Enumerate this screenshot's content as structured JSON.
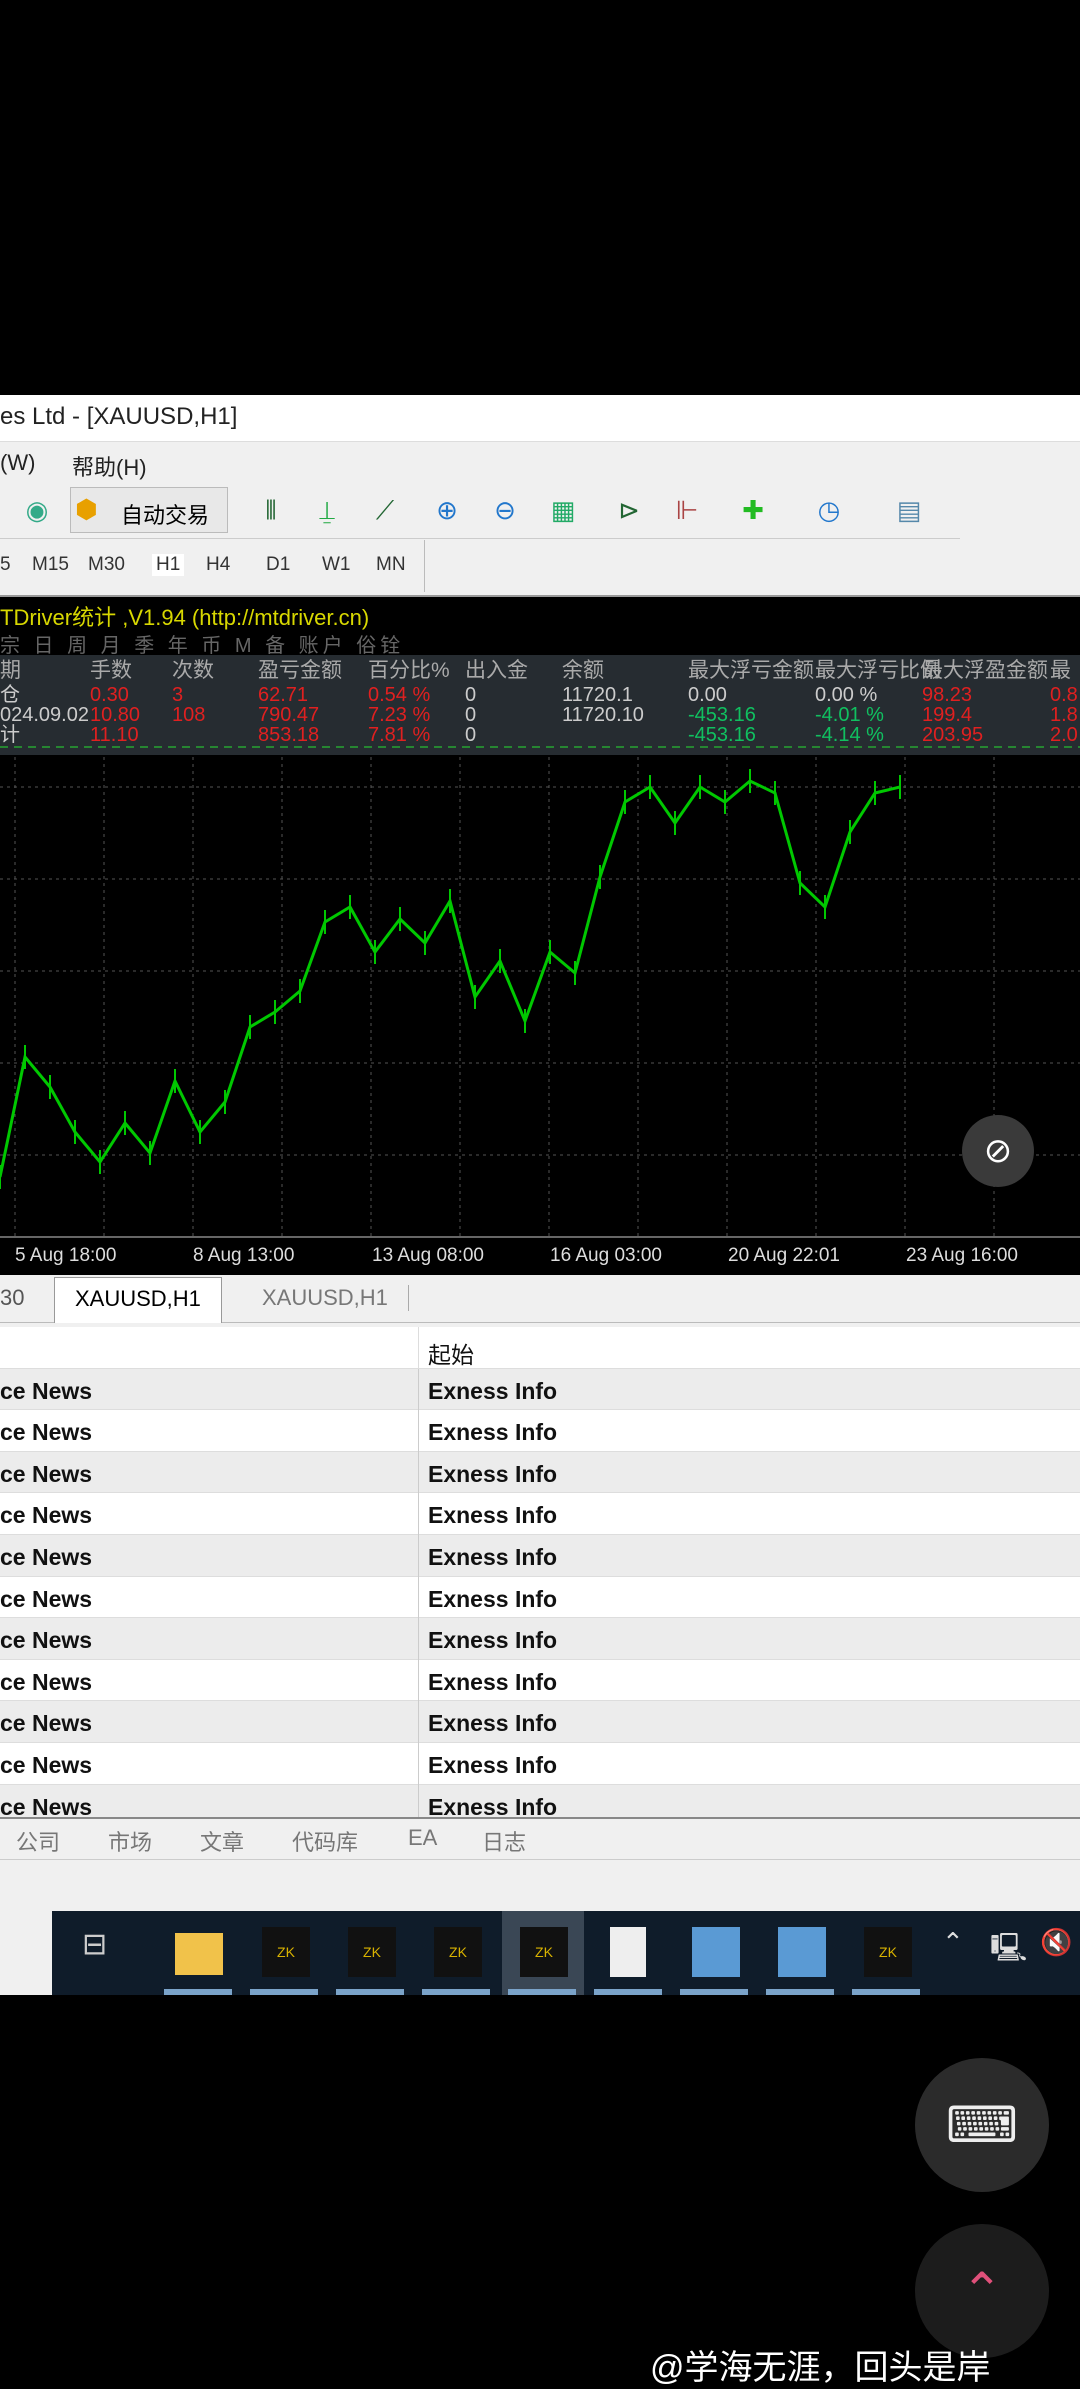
{
  "window": {
    "title": "es Ltd - [XAUUSD,H1]",
    "menu": [
      "(W)",
      "帮助(H)"
    ],
    "autotrade_label": "自动交易"
  },
  "timeframes": [
    "5",
    "M15",
    "M30",
    "H1",
    "H4",
    "D1",
    "W1",
    "MN"
  ],
  "indicator": {
    "title": "TDriver统计 ,V1.94 (http://mtdriver.cn)",
    "subtabs": "宗 日 周 月 季 年 币 M 备 账户 俗铨",
    "headers": [
      "期",
      "手数",
      "次数",
      "盈亏金额",
      "百分比%",
      "出入金",
      "余额",
      "最大浮亏金额",
      "最大浮亏比例",
      "最大浮盈金额",
      "最"
    ],
    "rows": [
      [
        "仓",
        "0.30",
        "3",
        "62.71",
        "0.54 %",
        "0",
        "11720.1",
        "0.00",
        "0.00 %",
        "98.23",
        "0.8"
      ],
      [
        "024.09.02",
        "10.80",
        "108",
        "790.47",
        "7.23 %",
        "0",
        "11720.10",
        "-453.16",
        "-4.01 %",
        "199.4",
        "1.8"
      ],
      [
        "计",
        "11.10",
        "",
        "853.18",
        "7.81 %",
        "0",
        "",
        "-453.16",
        "-4.14 %",
        "203.95",
        "2.0"
      ]
    ]
  },
  "chart_data": {
    "type": "line",
    "title": "XAUUSD,H1",
    "x_labels": [
      "5 Aug 18:00",
      "8 Aug 13:00",
      "13 Aug 08:00",
      "16 Aug 03:00",
      "20 Aug 22:01",
      "23 Aug 16:00"
    ],
    "values": [
      2380,
      2420,
      2410,
      2395,
      2385,
      2398,
      2388,
      2412,
      2395,
      2405,
      2430,
      2435,
      2442,
      2465,
      2470,
      2455,
      2466,
      2458,
      2472,
      2440,
      2452,
      2432,
      2455,
      2448,
      2480,
      2505,
      2510,
      2498,
      2510,
      2505,
      2512,
      2508,
      2478,
      2470,
      2495,
      2508,
      2510
    ],
    "ylim": [
      2370,
      2520
    ],
    "line_color": "#00c800"
  },
  "tabs": [
    "30",
    "XAUUSD,H1",
    "XAUUSD,H1"
  ],
  "news": {
    "col_header": "起始",
    "rows": [
      [
        "ce News",
        "Exness Info"
      ],
      [
        "ce News",
        "Exness Info"
      ],
      [
        "ce News",
        "Exness Info"
      ],
      [
        "ce News",
        "Exness Info"
      ],
      [
        "ce News",
        "Exness Info"
      ],
      [
        "ce News",
        "Exness Info"
      ],
      [
        "ce News",
        "Exness Info"
      ],
      [
        "ce News",
        "Exness Info"
      ],
      [
        "ce News",
        "Exness Info"
      ],
      [
        "ce News",
        "Exness Info"
      ],
      [
        "ce News",
        "Exness Info"
      ]
    ]
  },
  "bottom_tabs": [
    "公司",
    "市场",
    "文章",
    "代码库",
    "EA",
    "日志"
  ],
  "watermark": "@学海无涯，回头是岸"
}
